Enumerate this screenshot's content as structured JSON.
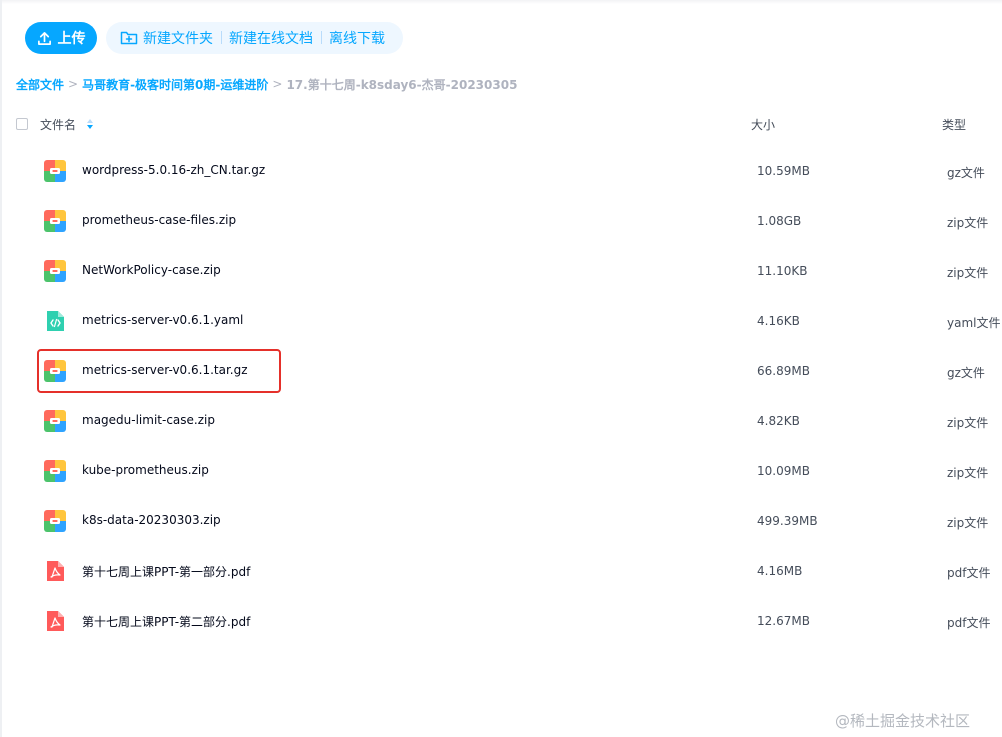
{
  "toolbar": {
    "upload_label": "上传",
    "new_folder_label": "新建文件夹",
    "new_doc_label": "新建在线文档",
    "offline_download_label": "离线下载"
  },
  "breadcrumb": {
    "root": "全部文件",
    "parent": "马哥教育-极客时间第0期-运维进阶",
    "current": "17.第十七周-k8sday6-杰哥-20230305",
    "separator": ">"
  },
  "header": {
    "name": "文件名",
    "size": "大小",
    "type": "类型"
  },
  "files": [
    {
      "name": "wordpress-5.0.16-zh_CN.tar.gz",
      "size": "10.59MB",
      "type": "gz文件",
      "icon": "archive-icon"
    },
    {
      "name": "prometheus-case-files.zip",
      "size": "1.08GB",
      "type": "zip文件",
      "icon": "archive-icon"
    },
    {
      "name": "NetWorkPolicy-case.zip",
      "size": "11.10KB",
      "type": "zip文件",
      "icon": "archive-icon"
    },
    {
      "name": "metrics-server-v0.6.1.yaml",
      "size": "4.16KB",
      "type": "yaml文件",
      "icon": "code-file-icon"
    },
    {
      "name": "metrics-server-v0.6.1.tar.gz",
      "size": "66.89MB",
      "type": "gz文件",
      "icon": "archive-icon"
    },
    {
      "name": "magedu-limit-case.zip",
      "size": "4.82KB",
      "type": "zip文件",
      "icon": "archive-icon"
    },
    {
      "name": "kube-prometheus.zip",
      "size": "10.09MB",
      "type": "zip文件",
      "icon": "archive-icon"
    },
    {
      "name": "k8s-data-20230303.zip",
      "size": "499.39MB",
      "type": "zip文件",
      "icon": "archive-icon"
    },
    {
      "name": "第十七周上课PPT-第一部分.pdf",
      "size": "4.16MB",
      "type": "pdf文件",
      "icon": "pdf-icon"
    },
    {
      "name": "第十七周上课PPT-第二部分.pdf",
      "size": "12.67MB",
      "type": "pdf文件",
      "icon": "pdf-icon"
    }
  ],
  "watermark": "@稀土掘金技术社区",
  "colors": {
    "accent": "#06a7ff",
    "highlight": "#e5302a"
  }
}
